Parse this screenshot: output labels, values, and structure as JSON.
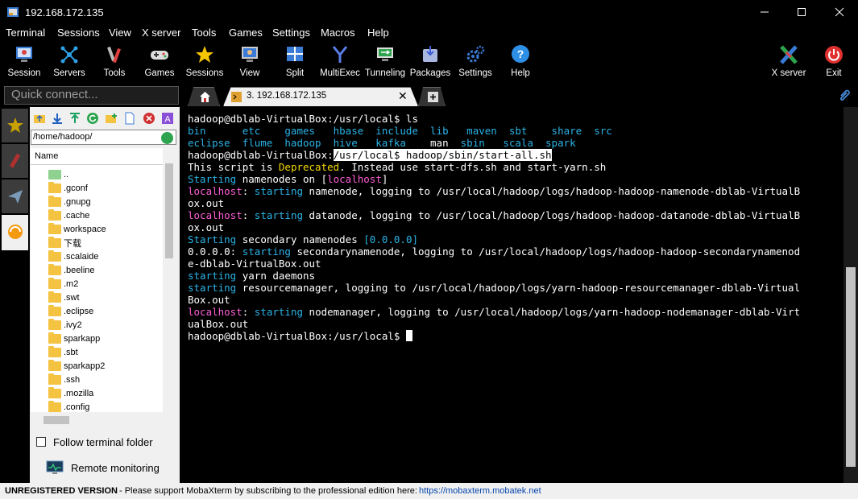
{
  "window": {
    "title": "192.168.172.135"
  },
  "menu": [
    "Terminal",
    "Sessions",
    "View",
    "X server",
    "Tools",
    "Games",
    "Settings",
    "Macros",
    "Help"
  ],
  "toolbar": {
    "items": [
      "Session",
      "Servers",
      "Tools",
      "Games",
      "Sessions",
      "View",
      "Split",
      "MultiExec",
      "Tunneling",
      "Packages",
      "Settings",
      "Help"
    ],
    "right": [
      "X server",
      "Exit"
    ]
  },
  "quick_connect": {
    "placeholder": "Quick connect..."
  },
  "tabs": {
    "session_label": "3. 192.168.172.135"
  },
  "sidebar": {
    "path": "/home/hadoop/",
    "column_header": "Name",
    "files": [
      "..",
      ".gconf",
      ".gnupg",
      ".cache",
      "workspace",
      "下载",
      ".scalaide",
      ".beeline",
      ".m2",
      ".swt",
      ".eclipse",
      ".ivy2",
      "sparkapp",
      ".sbt",
      "sparkapp2",
      ".ssh",
      ".mozilla",
      ".config"
    ],
    "follow_label": "Follow terminal folder",
    "remote_label": "Remote monitoring"
  },
  "terminal": {
    "lines": [
      [
        {
          "t": "hadoop@dblab-VirtualBox:/usr/local$ ls",
          "c": "wht"
        }
      ],
      [
        {
          "t": "bin      etc    games   hbase  include  lib   maven  sbt    share  src",
          "c": "cyan"
        }
      ],
      [
        {
          "t": "eclipse  flume  hadoop  hive   kafka    ",
          "c": "cyan"
        },
        {
          "t": "man",
          "c": "wht"
        },
        {
          "t": "  sbin   scala  spark",
          "c": "cyan"
        }
      ],
      [
        {
          "t": "hadoop@dblab-VirtualBox:",
          "c": "wht"
        },
        {
          "t": "/usr/local$ hadoop/sbin/start-all.sh",
          "c": "sel"
        }
      ],
      [
        {
          "t": "This script is ",
          "c": "wht"
        },
        {
          "t": "Deprecated",
          "c": "yel"
        },
        {
          "t": ". Instead use start-dfs.sh and start-yarn.sh",
          "c": "wht"
        }
      ],
      [
        {
          "t": "Starting",
          "c": "cyan"
        },
        {
          "t": " namenodes on [",
          "c": "wht"
        },
        {
          "t": "localhost",
          "c": "red"
        },
        {
          "t": "]",
          "c": "wht"
        }
      ],
      [
        {
          "t": "localhost",
          "c": "red"
        },
        {
          "t": ": ",
          "c": "wht"
        },
        {
          "t": "starting",
          "c": "cyan"
        },
        {
          "t": " namenode, logging to /usr/local/hadoop/logs/hadoop-hadoop-namenode-dblab-VirtualB",
          "c": "wht"
        }
      ],
      [
        {
          "t": "ox.out",
          "c": "wht"
        }
      ],
      [
        {
          "t": "localhost",
          "c": "red"
        },
        {
          "t": ": ",
          "c": "wht"
        },
        {
          "t": "starting",
          "c": "cyan"
        },
        {
          "t": " datanode, logging to /usr/local/hadoop/logs/hadoop-hadoop-datanode-dblab-VirtualB",
          "c": "wht"
        }
      ],
      [
        {
          "t": "ox.out",
          "c": "wht"
        }
      ],
      [
        {
          "t": "Starting",
          "c": "cyan"
        },
        {
          "t": " secondary namenodes ",
          "c": "wht"
        },
        {
          "t": "[0.0.0.0]",
          "c": "cyan"
        }
      ],
      [
        {
          "t": "0.0.0.0: ",
          "c": "wht"
        },
        {
          "t": "starting",
          "c": "cyan"
        },
        {
          "t": " secondarynamenode, logging to /usr/local/hadoop/logs/hadoop-hadoop-secondarynamenod",
          "c": "wht"
        }
      ],
      [
        {
          "t": "e-dblab-VirtualBox.out",
          "c": "wht"
        }
      ],
      [
        {
          "t": "starting",
          "c": "cyan"
        },
        {
          "t": " yarn daemons",
          "c": "wht"
        }
      ],
      [
        {
          "t": "starting",
          "c": "cyan"
        },
        {
          "t": " resourcemanager, logging to /usr/local/hadoop/logs/yarn-hadoop-resourcemanager-dblab-Virtual",
          "c": "wht"
        }
      ],
      [
        {
          "t": "Box.out",
          "c": "wht"
        }
      ],
      [
        {
          "t": "localhost",
          "c": "red"
        },
        {
          "t": ": ",
          "c": "wht"
        },
        {
          "t": "starting",
          "c": "cyan"
        },
        {
          "t": " nodemanager, logging to /usr/local/hadoop/logs/yarn-hadoop-nodemanager-dblab-Virt",
          "c": "wht"
        }
      ],
      [
        {
          "t": "ualBox.out",
          "c": "wht"
        }
      ],
      [
        {
          "t": "hadoop@dblab-VirtualBox:/usr/local$ ",
          "c": "wht"
        }
      ]
    ]
  },
  "status": {
    "version": "UNREGISTERED VERSION",
    "message": " -  Please support MobaXterm by subscribing to the professional edition here:",
    "link": "https://mobaxterm.mobatek.net"
  }
}
